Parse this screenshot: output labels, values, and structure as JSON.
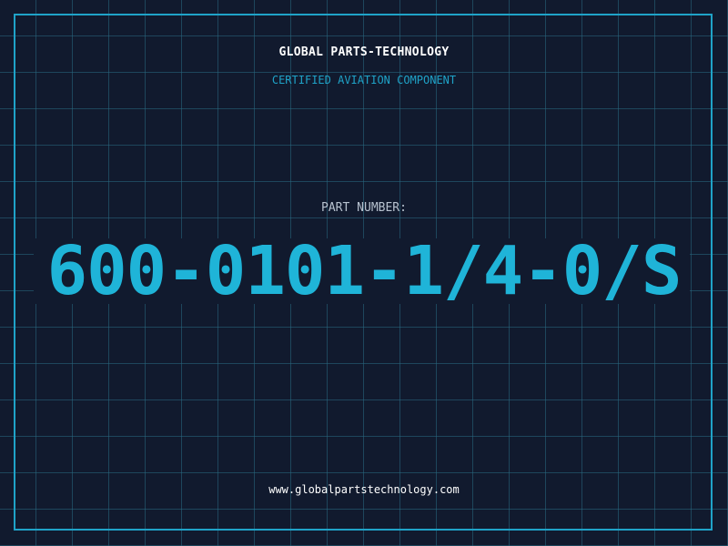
{
  "header": {
    "company": "GLOBAL PARTS-TECHNOLOGY",
    "tagline": "CERTIFIED AVIATION COMPONENT"
  },
  "part": {
    "label": "PART NUMBER:",
    "number": "600-0101-1/4-0/S"
  },
  "footer": {
    "website": "www.globalpartstechnology.com"
  },
  "colors": {
    "background": "#111a2e",
    "grid": "#286982",
    "accent": "#1fb4d8",
    "frame": "#1fa3c8",
    "text_primary": "#ffffff",
    "text_muted": "#b7c2cf"
  }
}
